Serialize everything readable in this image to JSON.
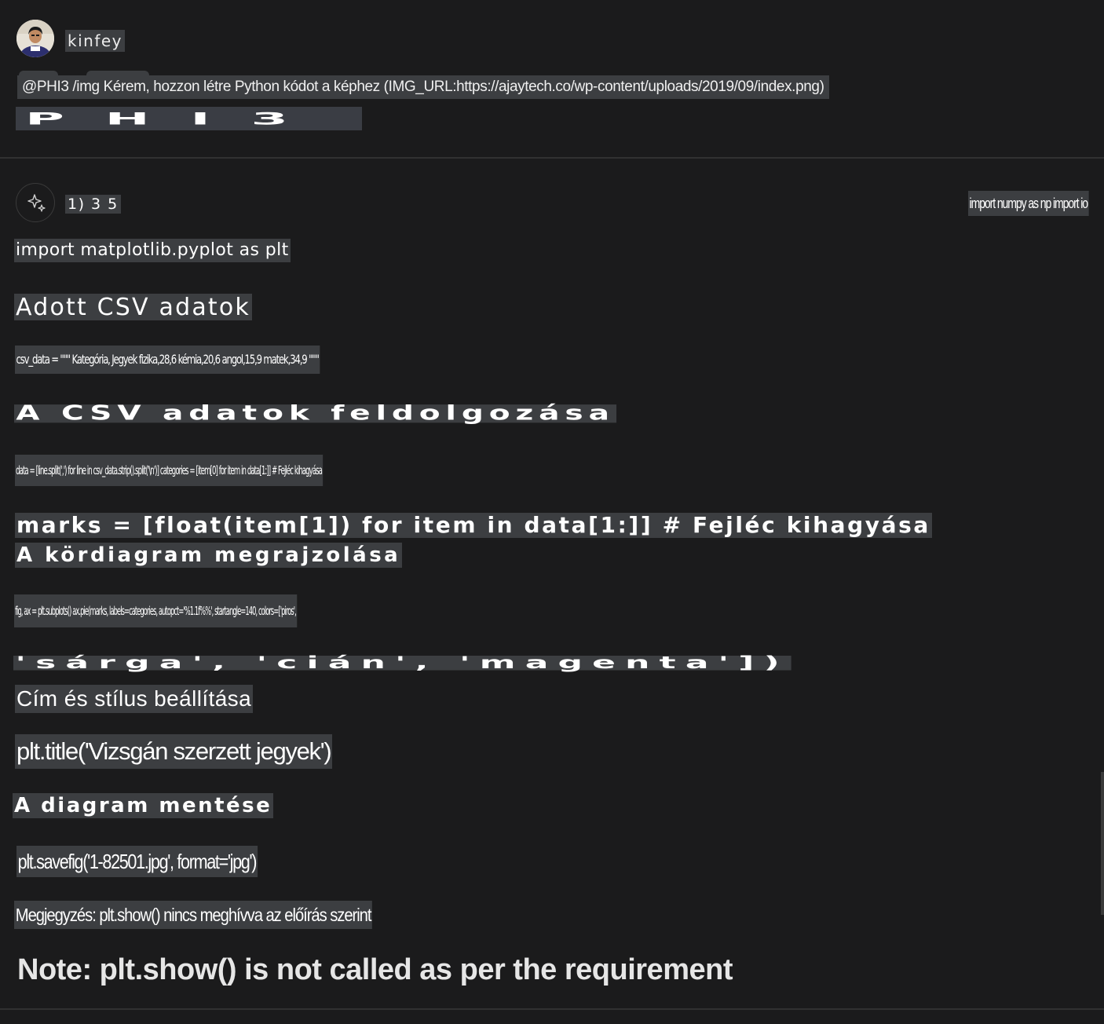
{
  "user_message": {
    "username": "kinfey",
    "prompt": "@PHI3 /img Kérem, hozzon létre Python kódot a képhez (IMG_URL:https://ajaytech.co/wp-content/uploads/2019/09/index.png)",
    "brand_image_text": "PHI3"
  },
  "bot_message": {
    "avatar_icon": "sparkle-icon",
    "meta": "1) 3 5",
    "side_code": "import numpy as np import io",
    "lines": {
      "l1": "import matplotlib.pyplot as plt",
      "l2": "Adott CSV adatok",
      "l3": "csv_data = \"\"\" Kategória, Jegyek fizika,28,6 kémia,20,6 angol,15,9 matek,34,9 \"\"\"",
      "l4": "A CSV adatok feldolgozása",
      "l5": "data = [line.split(',') for line in csv_data.strip().split('\\n')] categories = [item[0] for item in data[1:]] # Fejléc kihagyása",
      "l6": "marks = [float(item[1]) for item in data[1:]] # Fejléc kihagyása",
      "l7": "A kördiagram megrajzolása",
      "l8": "fig, ax = plt.subplots() ax.pie(marks, labels=categories, autopct='%1.1f%%', startangle=140, colors=['piros',",
      "l9": "'sárga', 'cián', 'magenta'])",
      "l10": "Cím és stílus beállítása",
      "l11": "plt.title('Vizsgán szerzett jegyek')",
      "l12": "A diagram mentése",
      "l13": "plt.savefig('1-82501.jpg', format='jpg')",
      "l14": "Megjegyzés: plt.show() nincs meghívva az előírás szerint"
    },
    "note": "Note: plt.show() is not called as per the requirement"
  },
  "colors": {
    "background": "#1b1b1c",
    "text_highlight": "#3c3e41",
    "divider": "#313131",
    "text": "#ffffff"
  }
}
